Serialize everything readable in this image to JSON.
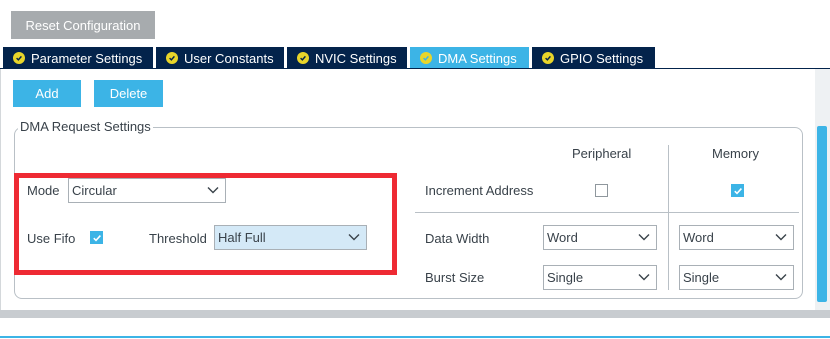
{
  "toolbar": {
    "reset_label": "Reset Configuration"
  },
  "tabs": [
    {
      "label": "Parameter Settings",
      "active": false
    },
    {
      "label": "User Constants",
      "active": false
    },
    {
      "label": "NVIC Settings",
      "active": false
    },
    {
      "label": "DMA Settings",
      "active": true
    },
    {
      "label": "GPIO Settings",
      "active": false
    }
  ],
  "actions": {
    "add_label": "Add",
    "delete_label": "Delete"
  },
  "dma_request": {
    "legend": "DMA Request Settings",
    "peripheral_header": "Peripheral",
    "memory_header": "Memory",
    "mode_label": "Mode",
    "mode_value": "Circular",
    "use_fifo_label": "Use Fifo",
    "use_fifo_checked": true,
    "threshold_label": "Threshold",
    "threshold_value": "Half Full",
    "increment_address_label": "Increment Address",
    "increment_peripheral_checked": false,
    "increment_memory_checked": true,
    "data_width_label": "Data Width",
    "data_width_peripheral": "Word",
    "data_width_memory": "Word",
    "burst_size_label": "Burst Size",
    "burst_size_peripheral": "Single",
    "burst_size_memory": "Single"
  },
  "colors": {
    "accent": "#3cb4e6",
    "tab_dark": "#03234b",
    "tab_check": "#e8d52a",
    "highlight_border": "#ee2a33"
  },
  "icons": [
    "check-circle-icon",
    "chevron-down-icon",
    "checkmark-icon"
  ]
}
